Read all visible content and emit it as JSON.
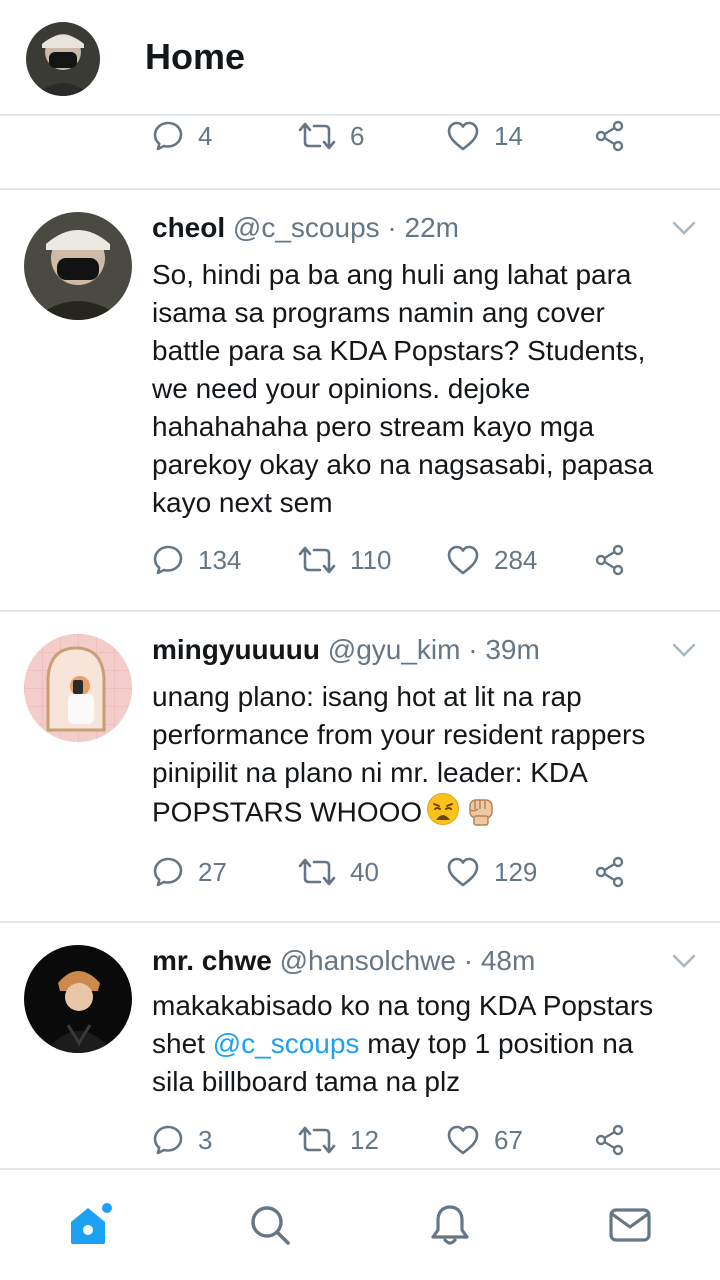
{
  "header": {
    "title": "Home"
  },
  "top_actions": {
    "replies": "4",
    "retweets": "6",
    "likes": "14"
  },
  "tweets": [
    {
      "name": "cheol",
      "handle": "@c_scoups",
      "time": "22m",
      "text_lines": [
        "So, hindi pa ba ang huli ang lahat para",
        "isama sa programs namin ang cover",
        "battle para sa KDA Popstars? Students,",
        "we need your opinions. dejoke",
        "hahahahaha pero stream kayo mga",
        "parekoy okay ako na nagsasabi, papasa",
        "kayo next sem"
      ],
      "replies": "134",
      "retweets": "110",
      "likes": "284"
    },
    {
      "name": "mingyuuuuu",
      "handle": "@gyu_kim",
      "time": "39m",
      "text_lines": [
        "unang plano: isang hot at lit na rap",
        "performance from your resident rappers",
        "pinipilit na plano ni mr. leader: KDA",
        "POPSTARS WHOOO"
      ],
      "emojis": [
        "weary-face-emoji",
        "raised-fist-emoji"
      ],
      "replies": "27",
      "retweets": "40",
      "likes": "129"
    },
    {
      "name": "mr. chwe",
      "handle": "@hansolchwe",
      "time": "48m",
      "text_lines": [
        "makakabisado ko na tong KDA Popstars",
        "shet",
        "@c_scoups",
        "may top 1 position na",
        "sila billboard tama na plz"
      ],
      "replies": "3",
      "retweets": "12",
      "likes": "67"
    }
  ],
  "sep": " · ",
  "icons": {
    "nav": [
      "home-icon",
      "search-icon",
      "notifications-icon",
      "messages-icon"
    ],
    "actions": [
      "reply-icon",
      "retweet-icon",
      "like-icon",
      "share-icon"
    ]
  },
  "colors": {
    "accent": "#1da1f2",
    "muted": "#657786",
    "text": "#14171a",
    "border": "#e1e8ed"
  }
}
